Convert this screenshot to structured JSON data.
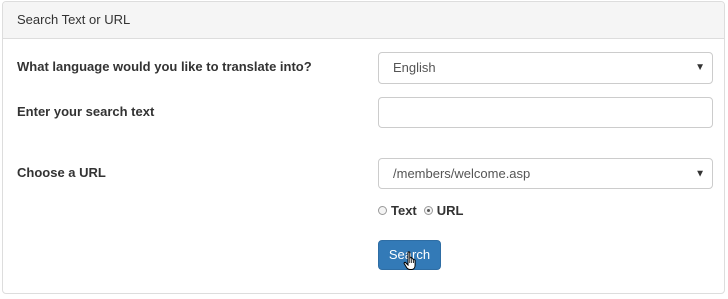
{
  "panel": {
    "heading": "Search Text or URL"
  },
  "form": {
    "language_label": "What language would you like to translate into?",
    "language_value": "English",
    "search_text_label": "Enter your search text",
    "search_text_value": "",
    "url_label": "Choose a URL",
    "url_value": "/members/welcome.asp",
    "radio_text_label": "Text",
    "radio_url_label": "URL",
    "selected_radio": "URL",
    "search_button_label": "Search"
  },
  "icons": {
    "dropdown": "chevron-down-icon",
    "cursor": "hand-pointer-icon"
  },
  "colors": {
    "button": "#337ab7",
    "heading_bg": "#f5f5f5",
    "border": "#dddddd"
  }
}
